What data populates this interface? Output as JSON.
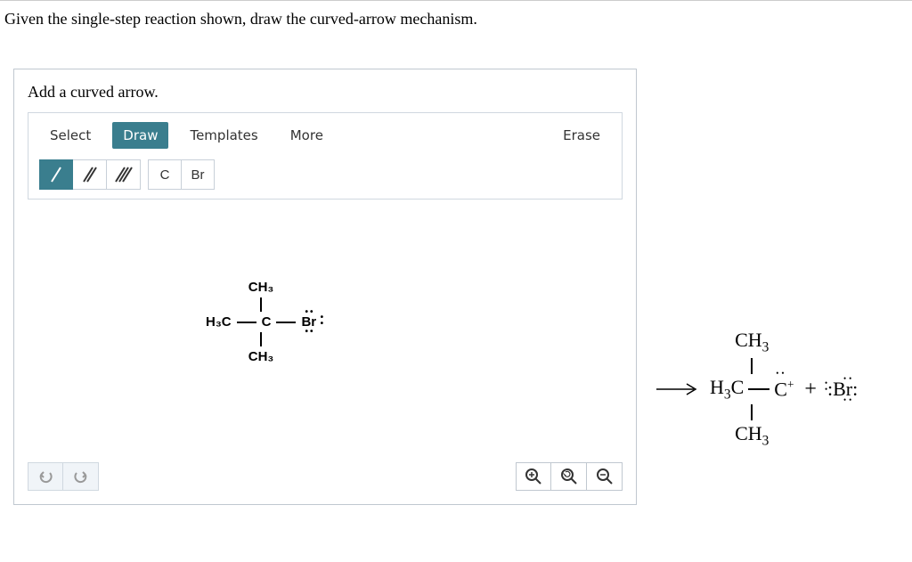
{
  "question": "Given the single-step reaction shown, draw the curved-arrow mechanism.",
  "editor": {
    "instruction": "Add a curved arrow.",
    "tabs": {
      "select": "Select",
      "draw": "Draw",
      "templates": "Templates",
      "more": "More",
      "erase": "Erase"
    },
    "elements": {
      "carbon": "C",
      "bromine": "Br"
    }
  },
  "reactant": {
    "ch3_top": "CH₃",
    "h3c_left": "H₃C",
    "center": "C",
    "br_right": "Br",
    "ch3_bottom": "CH₃"
  },
  "product": {
    "ch3_top": "CH",
    "ch3_top_sub": "3",
    "h3c_left": "H",
    "h3c_left_sub": "3",
    "h3c_left_c": "C",
    "center": "C",
    "charge": "+",
    "ch3_bottom": "CH",
    "ch3_bottom_sub": "3",
    "plus": "+",
    "br_label": "Br",
    "colon": ":"
  }
}
